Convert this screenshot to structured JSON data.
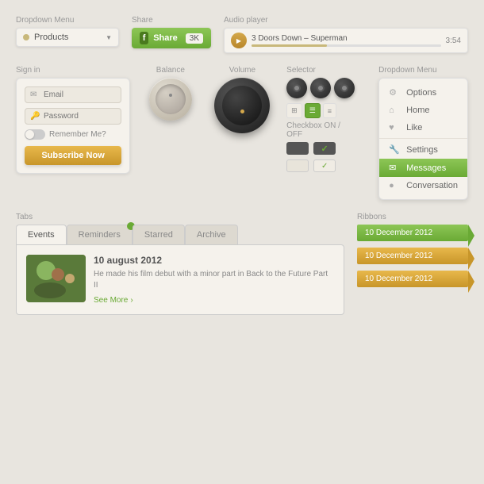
{
  "row1": {
    "dropdown_label": "Dropdown Menu",
    "dropdown_text": "Products",
    "share_label": "Share",
    "share_button": "Share",
    "share_count": "3K",
    "audio_label": "Audio player",
    "audio_title": "3 Doors Down – Superman",
    "audio_time": "3:54"
  },
  "row2": {
    "signin_label": "Sign in",
    "email_placeholder": "Email",
    "password_placeholder": "Password",
    "remember_label": "Remember Me?",
    "subscribe_label": "Subscribe Now",
    "balance_label": "Balance",
    "volume_label": "Volume",
    "selector_label": "Selector",
    "checkbox_label": "Checkbox ON / OFF",
    "dropdown2_label": "Dropdown Menu",
    "menu_items": [
      {
        "icon": "⚙",
        "label": "Options",
        "active": false
      },
      {
        "icon": "⌂",
        "label": "Home",
        "active": false
      },
      {
        "icon": "♥",
        "label": "Like",
        "active": false
      },
      {
        "icon": "🔧",
        "label": "Settings",
        "active": false
      },
      {
        "icon": "✉",
        "label": "Messages",
        "active": true
      },
      {
        "icon": "●",
        "label": "Conversation",
        "active": false
      }
    ]
  },
  "row3": {
    "tabs_label": "Tabs",
    "tabs": [
      {
        "label": "Events",
        "active": true,
        "badge": false
      },
      {
        "label": "Reminders",
        "active": false,
        "badge": true
      },
      {
        "label": "Starred",
        "active": false,
        "badge": false
      },
      {
        "label": "Archive",
        "active": false,
        "badge": false
      }
    ],
    "content_date": "10 august 2012",
    "content_desc": "He made his film debut with a minor part in Back to the Future Part II",
    "see_more": "See More",
    "ribbons_label": "Ribbons",
    "ribbons": [
      {
        "label": "10 December 2012",
        "color": "green"
      },
      {
        "label": "10 December 2012",
        "color": "gold"
      },
      {
        "label": "10 December 2012",
        "color": "gold"
      }
    ]
  }
}
